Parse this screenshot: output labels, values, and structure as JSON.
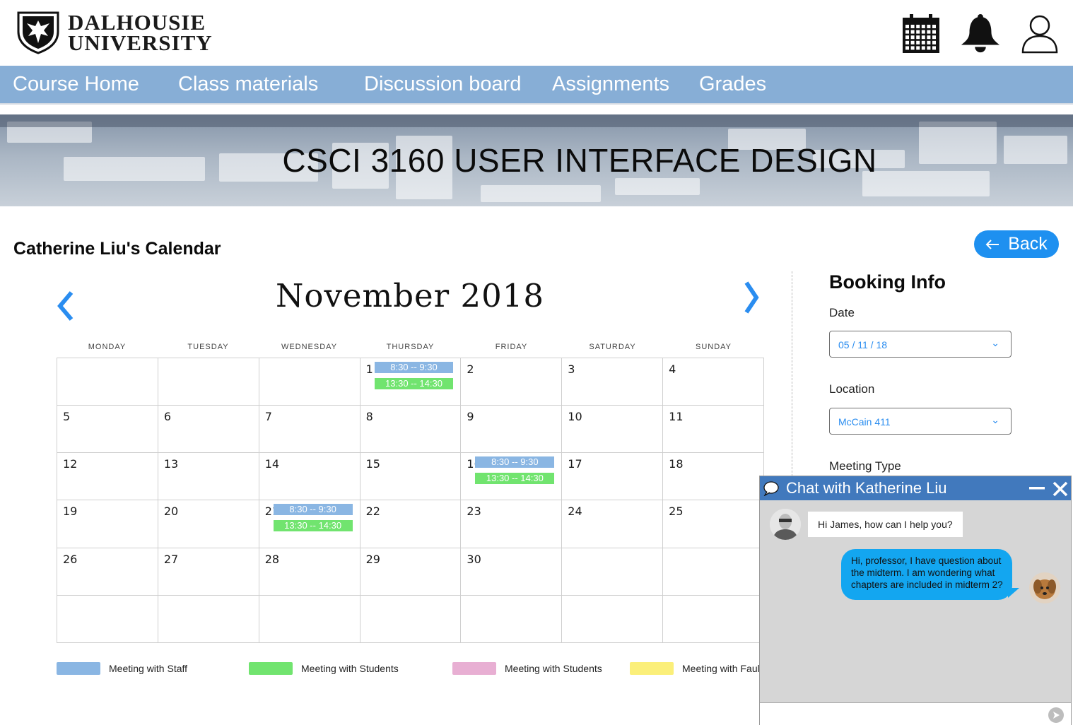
{
  "header": {
    "logo_line1": "DALHOUSIE",
    "logo_line2": "UNIVERSITY",
    "icons": [
      "calendar-icon",
      "bell-icon",
      "user-icon"
    ]
  },
  "nav": {
    "items": [
      "Course Home",
      "Class materials",
      "Discussion board",
      "Assignments",
      "Grades"
    ],
    "bg_color": "#87aed6"
  },
  "banner": {
    "title": "CSCI 3160 USER INTERFACE DESIGN"
  },
  "page": {
    "title": "Catherine Liu's Calendar",
    "back_label": "Back"
  },
  "calendar": {
    "month_label": "November 2018",
    "weekdays": [
      "MONDAY",
      "TUESDAY",
      "WEDNESDAY",
      "THURSDAY",
      "FRIDAY",
      "SATURDAY",
      "SUNDAY"
    ],
    "weeks": [
      [
        "",
        "",
        "",
        "1",
        "2",
        "3",
        "4"
      ],
      [
        "5",
        "6",
        "7",
        "8",
        "9",
        "10",
        "11"
      ],
      [
        "12",
        "13",
        "14",
        "15",
        "16",
        "17",
        "18"
      ],
      [
        "19",
        "20",
        "21",
        "22",
        "23",
        "24",
        "25"
      ],
      [
        "26",
        "27",
        "28",
        "29",
        "30",
        "",
        ""
      ],
      [
        "",
        "",
        "",
        "",
        "",
        "",
        ""
      ]
    ],
    "slot_staff": "8:30 -- 9:30",
    "slot_students": "13:30 -- 14:30",
    "booked_days": [
      "1",
      "16",
      "21"
    ]
  },
  "legend": [
    {
      "label": "Meeting with Staff",
      "color": "#8ab6e3"
    },
    {
      "label": "Meeting with Students",
      "color": "#71e46f"
    },
    {
      "label": "Meeting with Students",
      "color": "#e8afd3"
    },
    {
      "label": "Meeting with Faul",
      "color": "#fbef7a"
    }
  ],
  "booking": {
    "title": "Booking Info",
    "date_label": "Date",
    "date_value": "05 / 11 / 18",
    "location_label": "Location",
    "location_value": "McCain 411",
    "meeting_type_label": "Meeting Type"
  },
  "chat": {
    "title": "Chat with Katherine Liu",
    "incoming": "Hi James, how can I help you?",
    "outgoing": "Hi, professor, I have question about the midterm. I am wondering what chapters are included in midterm 2?"
  }
}
